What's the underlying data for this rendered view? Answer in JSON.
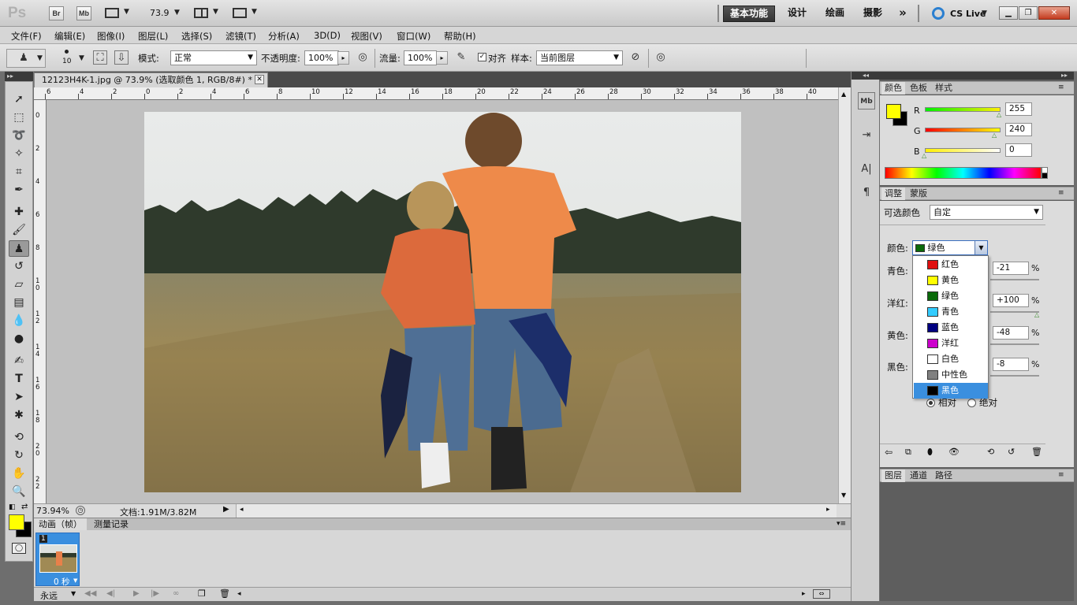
{
  "appbar": {
    "logo": "Ps",
    "bridge": "Br",
    "minibridge": "Mb",
    "zoom": "73.9",
    "workspaces": [
      "基本功能",
      "设计",
      "绘画",
      "摄影"
    ],
    "more": "»",
    "cslive": "CS Live"
  },
  "menus": [
    "文件(F)",
    "编辑(E)",
    "图像(I)",
    "图层(L)",
    "选择(S)",
    "滤镜(T)",
    "分析(A)",
    "3D(D)",
    "视图(V)",
    "窗口(W)",
    "帮助(H)"
  ],
  "options": {
    "brush_size": "10",
    "mode_label": "模式:",
    "mode_value": "正常",
    "opacity_label": "不透明度:",
    "opacity_value": "100%",
    "flow_label": "流量:",
    "flow_value": "100%",
    "aligned_label": "对齐",
    "sample_label": "样本:",
    "sample_value": "当前图层"
  },
  "document": {
    "tab_title": "12123H4K-1.jpg @ 73.9% (选取颜色 1, RGB/8#) *",
    "ruler_top": [
      "6",
      "4",
      "2",
      "0",
      "2",
      "4",
      "6",
      "8",
      "10",
      "12",
      "14",
      "16",
      "18",
      "20",
      "22",
      "24",
      "26",
      "28",
      "30",
      "32",
      "34",
      "36",
      "38",
      "40"
    ],
    "ruler_left": [
      "0",
      "2",
      "4",
      "6",
      "8",
      "1 0",
      "1 2",
      "1 4",
      "1 6",
      "1 8",
      "2 0",
      "2 2"
    ],
    "zoom_status": "73.94%",
    "doc_status": "文档:1.91M/3.82M"
  },
  "animation": {
    "tabs": [
      "动画（帧）",
      "测量记录"
    ],
    "frame_number": "1",
    "frame_delay": "0 秒",
    "loop": "永远"
  },
  "color_panel": {
    "tabs": [
      "颜色",
      "色板",
      "样式"
    ],
    "r_label": "R",
    "g_label": "G",
    "b_label": "B",
    "r": "255",
    "g": "240",
    "b": "0",
    "foreground": "#ffff00",
    "background": "#000000"
  },
  "adjust_panel": {
    "tabs": [
      "调整",
      "蒙版"
    ],
    "title": "可选颜色",
    "preset": "自定",
    "colors_label": "颜色:",
    "colors_value": "绿色",
    "cyan_label": "青色:",
    "cyan": "-21",
    "magenta_label": "洋红:",
    "magenta": "+100",
    "yellow_label": "黄色:",
    "yellow": "-48",
    "black_label": "黑色:",
    "black": "-8",
    "pct": "%",
    "relative": "相对",
    "absolute": "绝对",
    "dropdown": [
      {
        "label": "红色",
        "color": "#e01010"
      },
      {
        "label": "黄色",
        "color": "#ffff00"
      },
      {
        "label": "绿色",
        "color": "#0a6a0a"
      },
      {
        "label": "青色",
        "color": "#33ccff"
      },
      {
        "label": "蓝色",
        "color": "#000080"
      },
      {
        "label": "洋红",
        "color": "#cc00cc"
      },
      {
        "label": "白色",
        "color": "#ffffff"
      },
      {
        "label": "中性色",
        "color": "#808080"
      },
      {
        "label": "黑色",
        "color": "#000000"
      }
    ],
    "dropdown_selected": "黑色"
  },
  "layers_panel": {
    "tabs": [
      "图层",
      "通道",
      "路径"
    ]
  }
}
